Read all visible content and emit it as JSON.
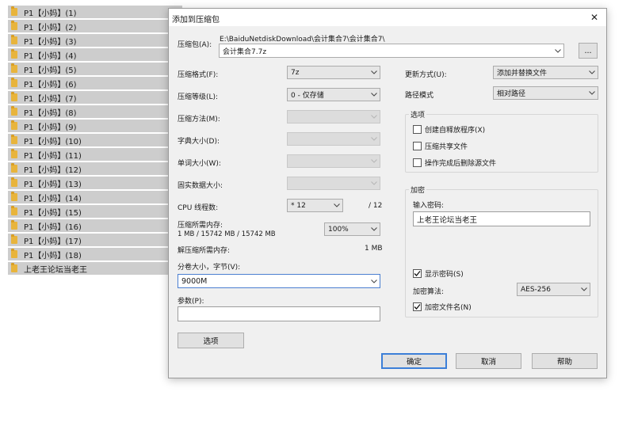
{
  "file_list": {
    "items": [
      "P1【小妈】(1)",
      "P1【小妈】(2)",
      "P1【小妈】(3)",
      "P1【小妈】(4)",
      "P1【小妈】(5)",
      "P1【小妈】(6)",
      "P1【小妈】(7)",
      "P1【小妈】(8)",
      "P1【小妈】(9)",
      "P1【小妈】(10)",
      "P1【小妈】(11)",
      "P1【小妈】(12)",
      "P1【小妈】(13)",
      "P1【小妈】(14)",
      "P1【小妈】(15)",
      "P1【小妈】(16)",
      "P1【小妈】(17)",
      "P1【小妈】(18)",
      "上老王论坛当老王"
    ]
  },
  "dialog": {
    "title": "添加到压缩包",
    "close_icon": "close-icon",
    "archive": {
      "label": "压缩包(A):",
      "path": "E:\\BaiduNetdiskDownload\\会计集合7\\会计集合7\\",
      "value": "会计集合7.7z",
      "browse_label": "..."
    },
    "left": {
      "format_label": "压缩格式(F):",
      "format_value": "7z",
      "level_label": "压缩等级(L):",
      "level_value": "0 - 仅存储",
      "method_label": "压缩方法(M):",
      "dict_label": "字典大小(D):",
      "word_label": "单词大小(W):",
      "solid_label": "固实数据大小:",
      "cpu_label": "CPU 线程数:",
      "cpu_value": "* 12",
      "cpu_max": "/ 12",
      "mem_comp_label": "压缩所需内存:",
      "mem_comp_detail": "1 MB / 15742 MB / 15742 MB",
      "mem_percent": "100%",
      "mem_decomp_label": "解压缩所需内存:",
      "mem_decomp_value": "1 MB",
      "split_label": "分卷大小，字节(V):",
      "split_value": "9000M",
      "params_label": "参数(P):",
      "params_value": "",
      "options_button": "选项"
    },
    "right": {
      "update_label": "更新方式(U):",
      "update_value": "添加并替换文件",
      "path_label": "路径模式",
      "path_value": "相对路径",
      "options_group": "选项",
      "opt_sfx": "创建自释放程序(X)",
      "opt_shared": "压缩共享文件",
      "opt_delete": "操作完成后删除源文件",
      "encrypt_group": "加密",
      "password_label": "输入密码:",
      "password_value": "上老王论坛当老王",
      "show_password": "显示密码(S)",
      "enc_method_label": "加密算法:",
      "enc_method_value": "AES-256",
      "encrypt_names": "加密文件名(N)"
    },
    "buttons": {
      "ok": "确定",
      "cancel": "取消",
      "help": "帮助"
    }
  }
}
